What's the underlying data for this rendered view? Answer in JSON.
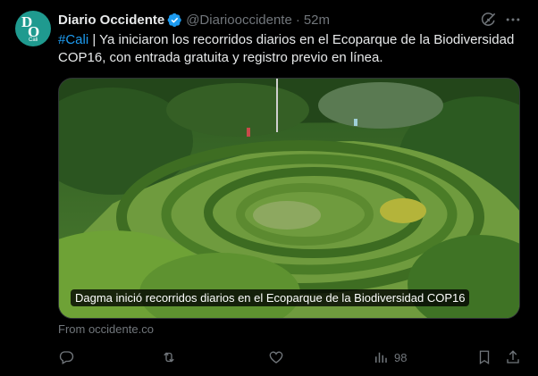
{
  "tweet": {
    "author_name": "Diario Occidente",
    "handle": "@Diariooccidente",
    "separator": "·",
    "time": "52m",
    "hashtag": "#Cali",
    "text": " | Ya iniciaron los recorridos diarios en el Ecoparque de la Biodiversidad COP16, con entrada gratuita y registro previo en línea.",
    "media_caption": "Dagma inició recorridos diarios en el Ecoparque de la Biodiversidad COP16",
    "source": "From occidente.co",
    "avatar": {
      "letters_top": "D",
      "letters_bottom": "O",
      "sub": "Cali"
    },
    "stats": {
      "views": "98"
    }
  },
  "icons": {
    "verified": "verified-badge-icon",
    "grok": "grok-icon",
    "more": "more-icon",
    "reply": "reply-icon",
    "retweet": "retweet-icon",
    "like": "heart-icon",
    "views": "views-icon",
    "bookmark": "bookmark-icon",
    "share": "share-icon"
  },
  "colors": {
    "background": "#000000",
    "text": "#e7e9ea",
    "secondary": "#71767b",
    "accent": "#1d9bf0",
    "avatar": "#1f9a8f"
  }
}
